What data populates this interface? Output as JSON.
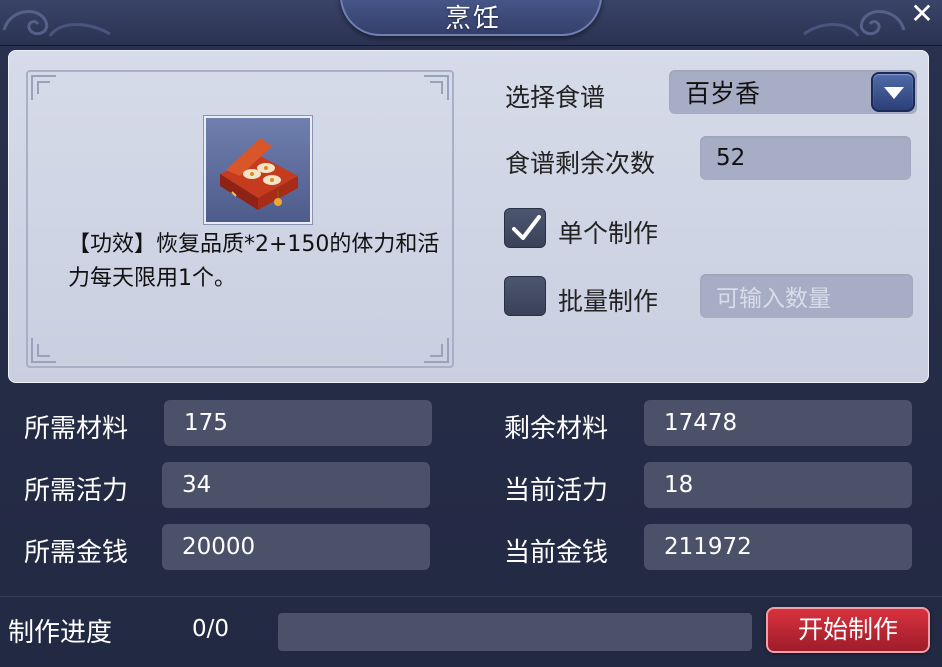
{
  "window": {
    "title": "烹饪",
    "close_label": "✕"
  },
  "item": {
    "icon": "food-box-icon",
    "description": "【功效】恢复品质*2+150的体力和活力每天限用1个。"
  },
  "recipe": {
    "select_label": "选择食谱",
    "selected": "百岁香",
    "remaining_label": "食谱剩余次数",
    "remaining_value": "52",
    "single_label": "单个制作",
    "single_checked": true,
    "batch_label": "批量制作",
    "batch_checked": false,
    "batch_placeholder": "可输入数量"
  },
  "stats": {
    "rows": [
      {
        "left_label": "所需材料",
        "left_value": "175",
        "right_label": "剩余材料",
        "right_value": "17478"
      },
      {
        "left_label": "所需活力",
        "left_value": "34",
        "right_label": "当前活力",
        "right_value": "18"
      },
      {
        "left_label": "所需金钱",
        "left_value": "20000",
        "right_label": "当前金钱",
        "right_value": "211972"
      }
    ]
  },
  "progress": {
    "label": "制作进度",
    "value": "0/0",
    "fraction": 0
  },
  "actions": {
    "start_label": "开始制作"
  },
  "colors": {
    "panel": "#d6dbe9",
    "field_light": "#a7adc4",
    "field_dark": "#4b5169",
    "start_button": "#c42a36"
  }
}
